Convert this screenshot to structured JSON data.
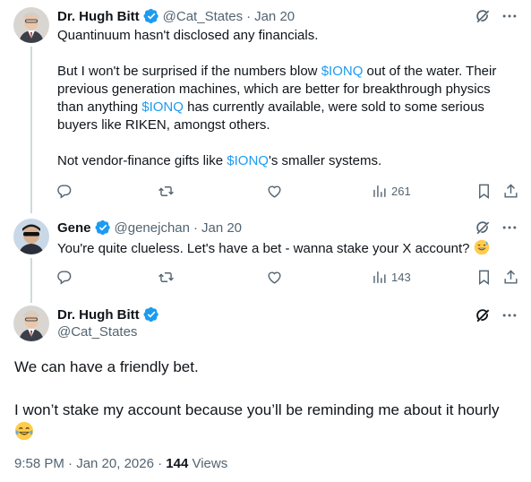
{
  "tweets": [
    {
      "name": "Dr. Hugh Bitt",
      "handle": "@Cat_States",
      "separator": "·",
      "time": "Jan 20",
      "paragraphs": [
        [
          {
            "t": "Quantinuum hasn't disclosed any financials."
          }
        ],
        [
          {
            "t": "But I won't be surprised if the numbers blow "
          },
          {
            "t": "$IONQ",
            "link": true
          },
          {
            "t": " out of the water. Their previous generation machines, which are better for breakthrough physics than anything "
          },
          {
            "t": "$IONQ",
            "link": true
          },
          {
            "t": " has currently available, were sold to some serious buyers like RIKEN, amongst others."
          }
        ],
        [
          {
            "t": "Not vendor-finance gifts like "
          },
          {
            "t": "$IONQ",
            "link": true
          },
          {
            "t": "'s smaller systems."
          }
        ]
      ],
      "views": "261"
    },
    {
      "name": "Gene",
      "handle": "@genejchan",
      "separator": "·",
      "time": "Jan 20",
      "paragraphs": [
        [
          {
            "t": "You're quite clueless. Let's have a bet - wanna stake your X account? "
          },
          {
            "emoji": "sweat-smile"
          }
        ]
      ],
      "views": "143"
    }
  ],
  "focused": {
    "name": "Dr. Hugh Bitt",
    "handle": "@Cat_States",
    "paragraphs": [
      [
        {
          "t": "We can have a friendly bet."
        }
      ],
      [
        {
          "t": "I won’t stake my account because you’ll be reminding me about it hourly"
        }
      ],
      [
        {
          "emoji": "tears-of-joy"
        }
      ]
    ],
    "timestamp": "9:58 PM · Jan 20, 2026 · ",
    "view_count": "144",
    "views_label": " Views"
  },
  "icons": {
    "verified": "verified-badge-icon",
    "grok": "grok-icon",
    "more": "more-icon",
    "reply": "reply-icon",
    "retweet": "retweet-icon",
    "like": "like-icon",
    "views": "views-icon",
    "bookmark": "bookmark-icon",
    "share": "share-icon"
  },
  "colors": {
    "link": "#1d9bf0",
    "muted": "#536471",
    "text": "#0f1419",
    "verified": "#1d9bf0",
    "line": "#cfd9de"
  }
}
